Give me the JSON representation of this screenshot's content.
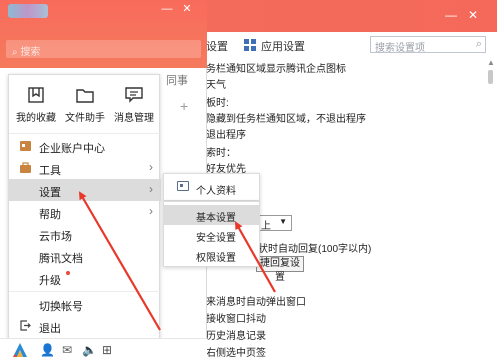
{
  "settings_window": {
    "tab_basic": "设置",
    "tab_app": "应用设置",
    "search_placeholder": "搜索设置项",
    "lines": [
      "务栏通知区域显示腾讯企点图标",
      "天气",
      "板时:",
      "隐藏到任务栏通知区域，不退出程序",
      "退出程序",
      "索时：",
      "好友优先",
      "上",
      "状时自动回复(100字以内)",
      "捷回复设置",
      "来消息时自动弹出窗口",
      "接收窗口抖动",
      "历史消息记录",
      "右侧选中页签"
    ]
  },
  "qq_panel": {
    "search_placeholder": "搜索",
    "tab_right": "同事"
  },
  "menu": {
    "quick_actions": [
      {
        "label": "我的收藏",
        "icon": "bookmark-icon"
      },
      {
        "label": "文件助手",
        "icon": "folder-icon"
      },
      {
        "label": "消息管理",
        "icon": "message-icon"
      }
    ],
    "items": {
      "enterprise": "企业账户中心",
      "tools": "工具",
      "settings": "设置",
      "help": "帮助",
      "cloud_market": "云市场",
      "tencent_docs": "腾讯文档",
      "upgrade": "升级",
      "switch_account": "切换帐号",
      "exit": "退出"
    }
  },
  "submenu": {
    "profile": "个人资料",
    "basic": "基本设置",
    "security": "安全设置",
    "permission": "权限设置"
  },
  "colors": {
    "header_red": "#f86b5c",
    "annotation_red": "#e8382a",
    "menu_highlight": "#dcdcdc"
  }
}
